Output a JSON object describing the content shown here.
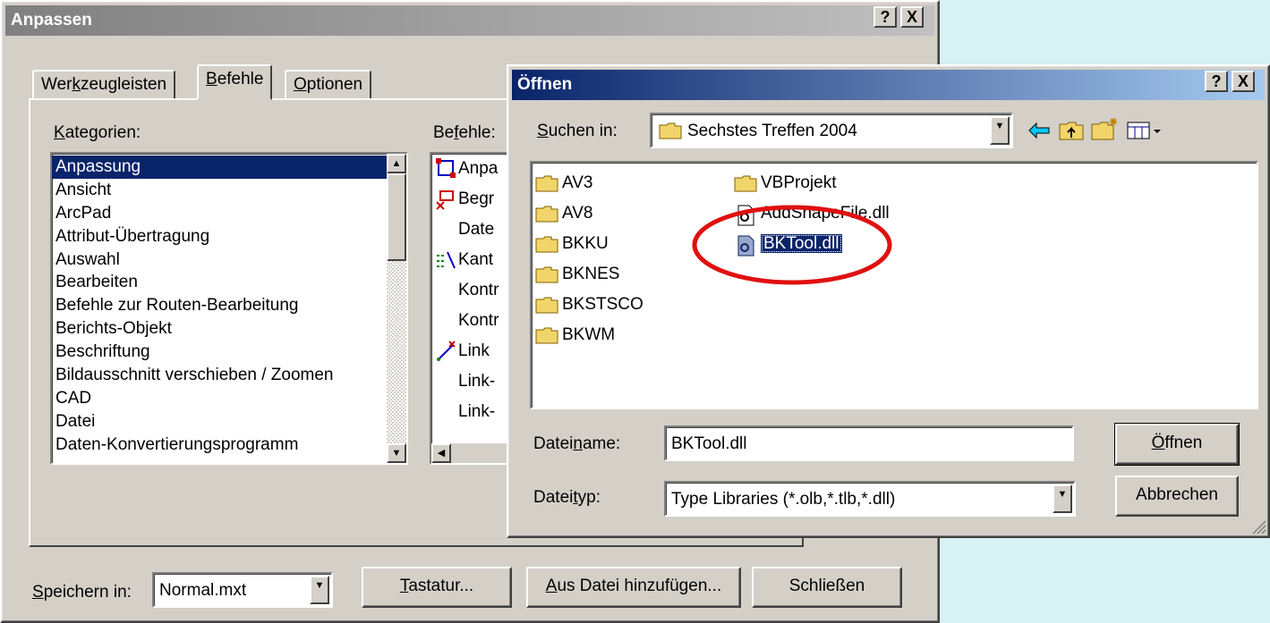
{
  "customize": {
    "title": "Anpassen",
    "help_btn": "?",
    "close_btn": "X",
    "tabs": [
      {
        "pre": "Wer",
        "acc": "k",
        "post": "zeugleisten"
      },
      {
        "pre": "",
        "acc": "B",
        "post": "efehle"
      },
      {
        "pre": "",
        "acc": "O",
        "post": "ptionen"
      }
    ],
    "categories_label": {
      "pre": "",
      "acc": "K",
      "post": "ategorien:"
    },
    "commands_label": {
      "pre": "Be",
      "acc": "f",
      "post": "ehle:"
    },
    "categories": [
      "Anpassung",
      "Ansicht",
      "ArcPad",
      "Attribut-Übertragung",
      "Auswahl",
      "Bearbeiten",
      "Befehle zur Routen-Bearbeitung",
      "Berichts-Objekt",
      "Beschriftung",
      "Bildausschnitt verschieben / Zoomen",
      "CAD",
      "Datei",
      "Daten-Konvertierungsprogramm"
    ],
    "commands": [
      {
        "icon": "square-nodes-icon",
        "label": "Anpa"
      },
      {
        "icon": "boundary-icon",
        "label": "Begr"
      },
      {
        "icon": "",
        "label": "Date"
      },
      {
        "icon": "edge-icon",
        "label": "Kant"
      },
      {
        "icon": "",
        "label": "Kontr"
      },
      {
        "icon": "",
        "label": "Kontr"
      },
      {
        "icon": "link-icon",
        "label": "Link"
      },
      {
        "icon": "",
        "label": "Link-"
      },
      {
        "icon": "",
        "label": "Link-"
      }
    ],
    "save_in_label": {
      "pre": "",
      "acc": "S",
      "post": "peichern in:"
    },
    "save_in_value": "Normal.mxt",
    "keyboard_btn": {
      "pre": "",
      "acc": "T",
      "post": "astatur..."
    },
    "add_from_file_btn": {
      "pre": "",
      "acc": "A",
      "post": "us Datei hinzufügen..."
    },
    "close_button": "Schließen"
  },
  "open_dialog": {
    "title": "Öffnen",
    "help_btn": "?",
    "close_btn": "X",
    "look_in_label": {
      "pre": "",
      "acc": "S",
      "post": "uchen in:"
    },
    "look_in_value": "Sechstes Treffen 2004",
    "files_col1": [
      "AV3",
      "AV8",
      "BKKU",
      "BKNES",
      "BKSTSCO",
      "BKWM"
    ],
    "files_col2": [
      {
        "name": "VBProjekt",
        "type": "folder"
      },
      {
        "name": "AddShapeFile.dll",
        "type": "dll"
      },
      {
        "name": "BKTool.dll",
        "type": "dll",
        "selected": true
      }
    ],
    "filename_label": {
      "pre": "Datei",
      "acc": "n",
      "post": "ame:"
    },
    "filename_value": "BKTool.dll",
    "filetype_label": {
      "pre": "Datei",
      "acc": "t",
      "post": "yp:"
    },
    "filetype_value": "Type Libraries (*.olb,*.tlb,*.dll)",
    "open_btn": {
      "pre": "",
      "acc": "Ö",
      "post": "ffnen"
    },
    "cancel_btn": "Abbrechen"
  },
  "highlight_color": "#e01010",
  "icons": [
    "back-arrow-icon",
    "up-folder-icon",
    "new-folder-icon",
    "view-menu-icon"
  ]
}
